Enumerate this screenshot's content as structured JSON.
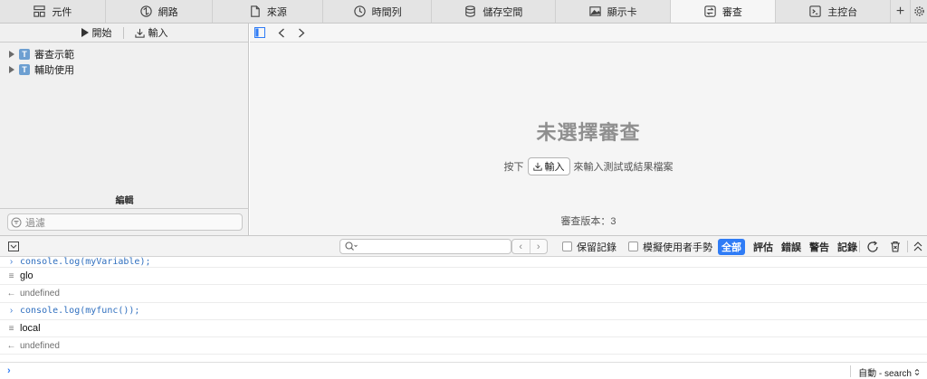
{
  "tabs": [
    {
      "id": "elements",
      "label": "元件",
      "icon": "elements-icon",
      "width": 117
    },
    {
      "id": "network",
      "label": "網路",
      "icon": "network-icon",
      "width": 118
    },
    {
      "id": "sources",
      "label": "來源",
      "icon": "sources-icon",
      "width": 123
    },
    {
      "id": "timelines",
      "label": "時間列",
      "icon": "timelines-icon",
      "width": 120
    },
    {
      "id": "storage",
      "label": "儲存空間",
      "icon": "storage-icon",
      "width": 137
    },
    {
      "id": "graphics",
      "label": "顯示卡",
      "icon": "graphics-icon",
      "width": 127
    },
    {
      "id": "audit",
      "label": "審查",
      "icon": "audit-icon",
      "width": 117,
      "active": true
    },
    {
      "id": "console",
      "label": "主控台",
      "icon": "console-icon",
      "width": 127
    }
  ],
  "left_panel": {
    "start_label": "開始",
    "import_label": "輸入",
    "tree": [
      {
        "icon_letter": "T",
        "label": "審查示範"
      },
      {
        "icon_letter": "T",
        "label": "輔助使用"
      }
    ],
    "edit_label": "編輯",
    "filter_placeholder": "過濾"
  },
  "right_panel": {
    "empty_title": "未選擇審查",
    "hint_before": "按下",
    "hint_button": "輸入",
    "hint_after": "來輸入測試或結果檔案",
    "version": "審查版本：3"
  },
  "console_toolbar": {
    "search_placeholder": "",
    "preserve_log": "保留記錄",
    "emulate_user_gesture": "模擬使用者手勢",
    "filters": [
      "全部",
      "評估",
      "錯誤",
      "警告",
      "記錄"
    ]
  },
  "console_log": [
    {
      "kind": "input",
      "text": "console.log(myVariable);"
    },
    {
      "kind": "output",
      "text": "glo"
    },
    {
      "kind": "result",
      "text": "undefined"
    },
    {
      "kind": "input",
      "text": "console.log(myfunc());"
    },
    {
      "kind": "output",
      "text": "local"
    },
    {
      "kind": "result",
      "text": "undefined"
    }
  ],
  "prompt": {
    "context_label": "自動 - search"
  },
  "colors": {
    "accent": "#2f7cf6",
    "code": "#2f6fbf"
  }
}
